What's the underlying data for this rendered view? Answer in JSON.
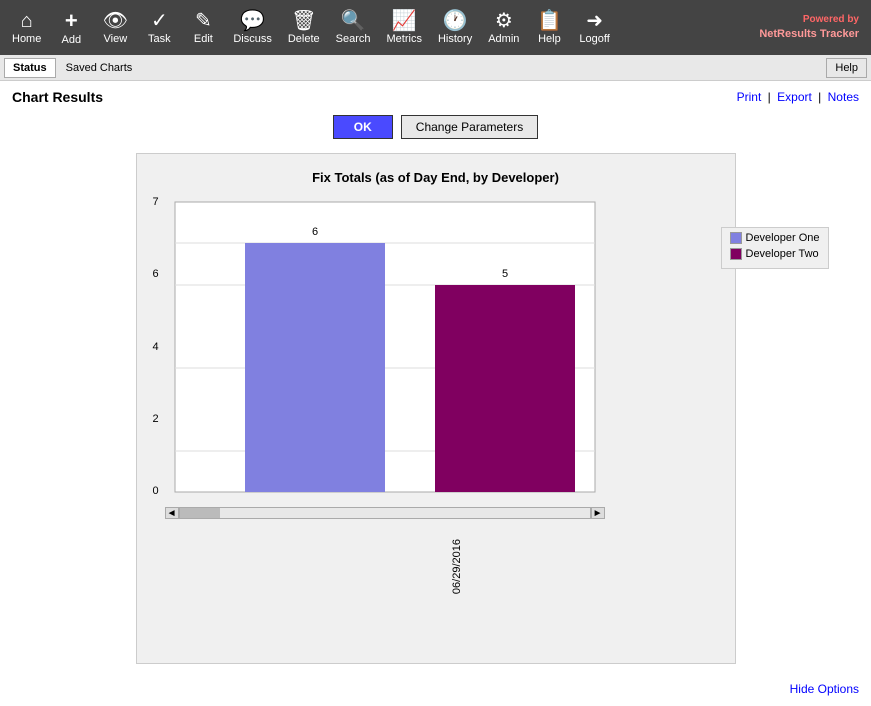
{
  "navbar": {
    "brand": "Powered by",
    "brand_name": "NetResults Tracker",
    "items": [
      {
        "label": "Home",
        "icon": "⌂",
        "name": "home"
      },
      {
        "label": "Add",
        "icon": "+",
        "name": "add"
      },
      {
        "label": "View",
        "icon": "👁",
        "name": "view"
      },
      {
        "label": "Task",
        "icon": "✓",
        "name": "task"
      },
      {
        "label": "Edit",
        "icon": "✎",
        "name": "edit"
      },
      {
        "label": "Discuss",
        "icon": "💬",
        "name": "discuss"
      },
      {
        "label": "Delete",
        "icon": "🗑",
        "name": "delete"
      },
      {
        "label": "Search",
        "icon": "🔍",
        "name": "search"
      },
      {
        "label": "Metrics",
        "icon": "📈",
        "name": "metrics"
      },
      {
        "label": "History",
        "icon": "🕐",
        "name": "history"
      },
      {
        "label": "Admin",
        "icon": "⚙",
        "name": "admin"
      },
      {
        "label": "Help",
        "icon": "📋",
        "name": "help"
      },
      {
        "label": "Logoff",
        "icon": "→",
        "name": "logoff"
      }
    ]
  },
  "secondbar": {
    "status_label": "Status",
    "saved_charts_label": "Saved Charts",
    "help_label": "Help"
  },
  "page": {
    "title": "Chart Results",
    "print_label": "Print",
    "export_label": "Export",
    "notes_label": "Notes",
    "ok_label": "OK",
    "change_params_label": "Change Parameters"
  },
  "chart": {
    "title": "Fix Totals (as of Day End, by Developer)",
    "x_label": "06/29/2016",
    "y_max": 7,
    "y_labels": [
      "7",
      "6",
      "4",
      "2",
      "0"
    ],
    "bars": [
      {
        "label": "Developer One",
        "value": 6,
        "color": "#8080e0"
      },
      {
        "label": "Developer Two",
        "value": 5,
        "color": "#800060"
      }
    ]
  },
  "footer": {
    "hide_options_label": "Hide Options"
  }
}
